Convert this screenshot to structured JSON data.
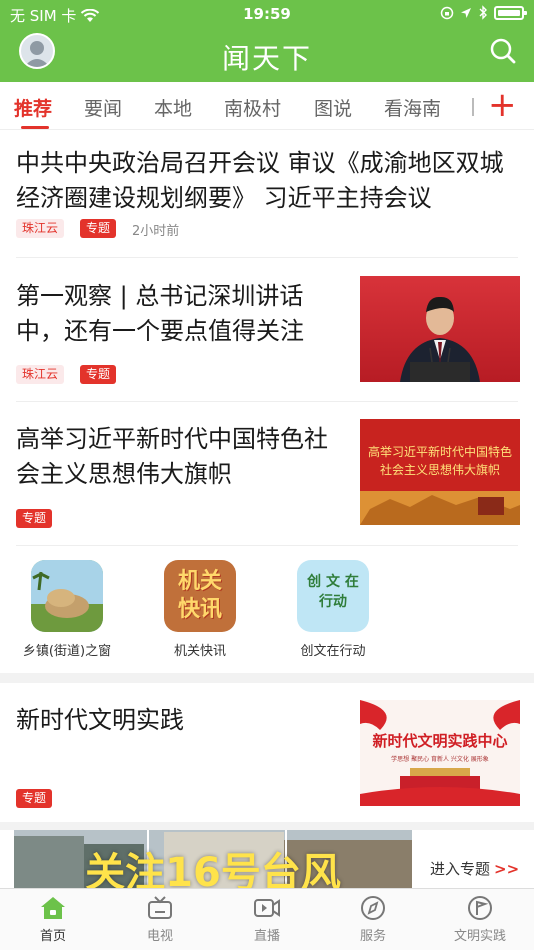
{
  "status_bar": {
    "carrier": "无 SIM 卡",
    "time": "19:59"
  },
  "header": {
    "title": "闻天下"
  },
  "tabs": [
    {
      "label": "推荐",
      "active": true
    },
    {
      "label": "要闻"
    },
    {
      "label": "本地"
    },
    {
      "label": "南极村"
    },
    {
      "label": "图说"
    },
    {
      "label": "看海南"
    }
  ],
  "news": [
    {
      "title": "中共中央政治局召开会议 审议《成渝地区双城经济圈建设规划纲要》 习近平主持会议",
      "source": "珠江云",
      "tag": "专题",
      "time": "2小时前"
    },
    {
      "title": "第一观察 | 总书记深圳讲话中，还有一个要点值得关注",
      "source": "珠江云",
      "tag": "专题"
    },
    {
      "title": "高举习近平新时代中国特色社会主义思想伟大旗帜",
      "tag": "专题",
      "thumb_text": "高举习近平新时代中国特色社会主义思想伟大旗帜"
    }
  ],
  "quick_links": [
    {
      "label": "乡镇(街道)之窗"
    },
    {
      "label": "机关快讯",
      "icon_text": "机关快讯"
    },
    {
      "label": "创文在行动",
      "icon_text": "创 文 在行动"
    }
  ],
  "feature": {
    "title": "新时代文明实践",
    "tag": "专题",
    "thumb_text": "新时代文明实践中心",
    "thumb_sub": "学思想 聚民心 育新人 兴文化 展形象"
  },
  "banner": {
    "text": "关注16号台风",
    "enter_label": "进入专题",
    "arrow": ">>"
  },
  "bottom_nav": [
    {
      "label": "首页",
      "active": true,
      "icon": "home-icon"
    },
    {
      "label": "电视",
      "icon": "tv-icon"
    },
    {
      "label": "直播",
      "icon": "live-icon"
    },
    {
      "label": "服务",
      "icon": "compass-icon"
    },
    {
      "label": "文明实践",
      "icon": "flag-circle-icon"
    }
  ],
  "colors": {
    "brand_green": "#6cc24a",
    "accent_red": "#e3332b"
  }
}
